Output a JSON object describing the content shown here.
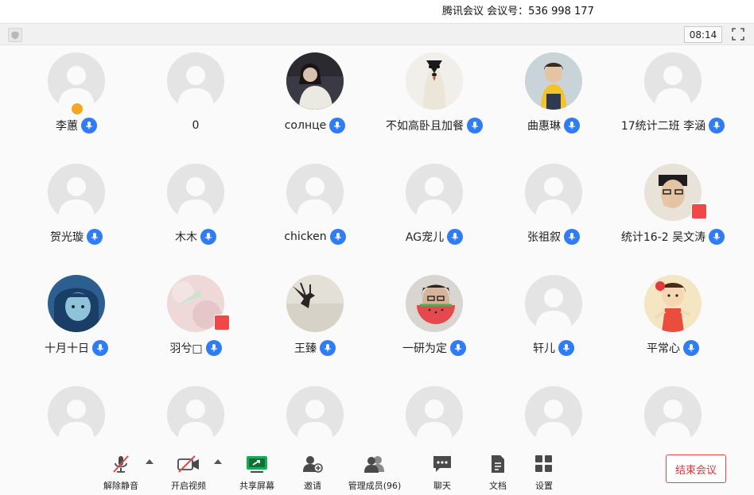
{
  "title": "腾讯会议 会议号：536 998 177",
  "timer": "08:14",
  "participants": [
    {
      "name": "李蕙",
      "avatar": "default",
      "host": true
    },
    {
      "name": "0",
      "avatar": "default"
    },
    {
      "name": "солнце",
      "avatar": "photo-girl-night"
    },
    {
      "name": "不如高卧且加餐",
      "avatar": "photo-dog"
    },
    {
      "name": "曲惠琳",
      "avatar": "photo-child-yellow"
    },
    {
      "name": "17统计二班  李涵",
      "avatar": "default"
    },
    {
      "name": "贺光璇",
      "avatar": "default"
    },
    {
      "name": "木木",
      "avatar": "default"
    },
    {
      "name": "chicken",
      "avatar": "default"
    },
    {
      "name": "AG宠儿",
      "avatar": "default"
    },
    {
      "name": "张祖叙",
      "avatar": "default"
    },
    {
      "name": "统计16-2 吴文涛",
      "avatar": "photo-man-glasses",
      "video": true
    },
    {
      "name": "十月十日",
      "avatar": "drawing-blue-hair"
    },
    {
      "name": "羽兮□",
      "avatar": "photo-pink",
      "video": true
    },
    {
      "name": "王臻",
      "avatar": "photo-hand-sky"
    },
    {
      "name": "一研为定",
      "avatar": "photo-watermelon"
    },
    {
      "name": "轩儿",
      "avatar": "default"
    },
    {
      "name": "平常心",
      "avatar": "cartoon-girl"
    },
    {
      "name": "",
      "avatar": "default"
    },
    {
      "name": "",
      "avatar": "default"
    },
    {
      "name": "",
      "avatar": "default"
    },
    {
      "name": "",
      "avatar": "default"
    },
    {
      "name": "",
      "avatar": "default"
    },
    {
      "name": "",
      "avatar": "default"
    }
  ],
  "toolbar": {
    "unmute": "解除静音",
    "start_video": "开启视频",
    "share_screen": "共享屏幕",
    "invite": "邀请",
    "manage_members": "管理成员(96)",
    "chat": "聊天",
    "docs": "文档",
    "settings": "设置",
    "end_meeting": "结束会议"
  },
  "colors": {
    "accent": "#2f7cf6",
    "danger": "#e0484d",
    "share": "#1aad55"
  }
}
